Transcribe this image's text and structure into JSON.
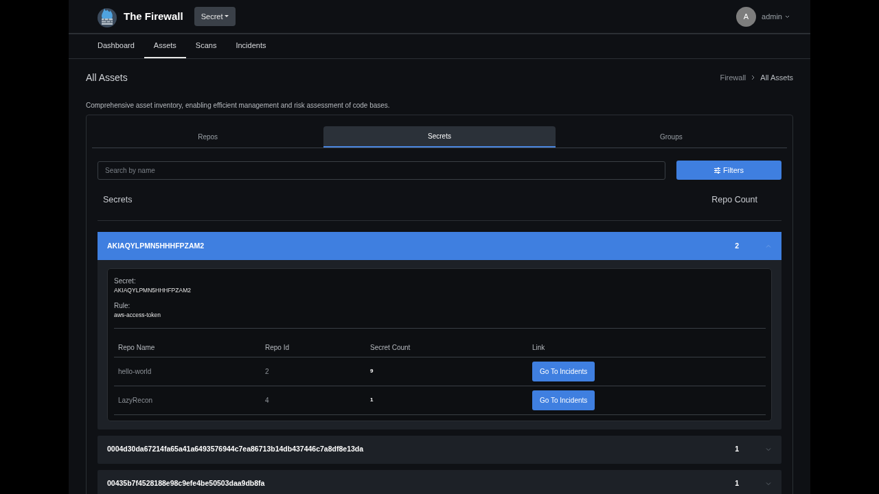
{
  "header": {
    "brand": "The Firewall",
    "scope_dropdown": "Secret",
    "user": {
      "avatar_initial": "A",
      "name": "admin"
    }
  },
  "nav": [
    {
      "label": "Dashboard",
      "selected": false
    },
    {
      "label": "Assets",
      "selected": true
    },
    {
      "label": "Scans",
      "selected": false
    },
    {
      "label": "Incidents",
      "selected": false
    }
  ],
  "page": {
    "title": "All Assets",
    "breadcrumb": [
      "Firewall",
      "All Assets"
    ],
    "description": "Comprehensive asset inventory, enabling efficient management and risk assessment of code bases."
  },
  "tabs": [
    {
      "label": "Repos",
      "selected": false
    },
    {
      "label": "Secrets",
      "selected": true
    },
    {
      "label": "Groups",
      "selected": false
    }
  ],
  "search": {
    "placeholder": "Search by name"
  },
  "filters_button": "Filters",
  "list_header": {
    "name": "Secrets",
    "count": "Repo Count"
  },
  "secrets": [
    {
      "name": "AKIAQYLPMN5HHHFPZAM2",
      "repo_count": "2",
      "expanded": true,
      "detail": {
        "secret_label": "Secret:",
        "secret_value": "AKIAQYLPMN5HHHFPZAM2",
        "rule_label": "Rule:",
        "rule_value": "aws-access-token",
        "columns": [
          "Repo Name",
          "Repo Id",
          "Secret Count",
          "Link"
        ],
        "rows": [
          {
            "repo_name": "hello-world",
            "repo_id": "2",
            "secret_count": "9",
            "link": "Go To Incidents"
          },
          {
            "repo_name": "LazyRecon",
            "repo_id": "4",
            "secret_count": "1",
            "link": "Go To Incidents"
          }
        ]
      }
    },
    {
      "name": "0004d30da67214fa65a41a6493576944c7ea86713b14db437446c7a8df8e13da",
      "repo_count": "1",
      "expanded": false
    },
    {
      "name": "00435b7f4528188e98c9efe4be50503daa9db8fa",
      "repo_count": "1",
      "expanded": false
    }
  ]
}
